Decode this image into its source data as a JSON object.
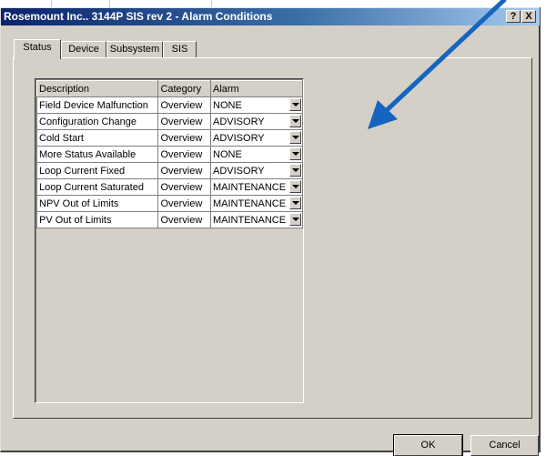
{
  "window": {
    "title": "Rosemount Inc.. 3144P SIS rev 2 - Alarm Conditions",
    "help_glyph": "?",
    "close_glyph": "X"
  },
  "tabs": [
    {
      "label": "Status",
      "active": true
    },
    {
      "label": "Device",
      "active": false
    },
    {
      "label": "Subsystem",
      "active": false
    },
    {
      "label": "SIS",
      "active": false
    }
  ],
  "table": {
    "headers": [
      "Description",
      "Category",
      "Alarm"
    ],
    "rows": [
      {
        "description": "Field Device Malfunction",
        "category": "Overview",
        "alarm": "NONE"
      },
      {
        "description": "Configuration Change",
        "category": "Overview",
        "alarm": "ADVISORY"
      },
      {
        "description": "Cold Start",
        "category": "Overview",
        "alarm": "ADVISORY"
      },
      {
        "description": "More Status Available",
        "category": "Overview",
        "alarm": "NONE"
      },
      {
        "description": "Loop Current Fixed",
        "category": "Overview",
        "alarm": "ADVISORY"
      },
      {
        "description": "Loop Current Saturated",
        "category": "Overview",
        "alarm": "MAINTENANCE"
      },
      {
        "description": "NPV Out of Limits",
        "category": "Overview",
        "alarm": "MAINTENANCE"
      },
      {
        "description": "PV Out of Limits",
        "category": "Overview",
        "alarm": "MAINTENANCE"
      }
    ]
  },
  "buttons": {
    "ok": "OK",
    "cancel": "Cancel"
  },
  "colors": {
    "title_start": "#0a246a",
    "title_end": "#a6caf0",
    "annotation_arrow": "#1565c0"
  }
}
